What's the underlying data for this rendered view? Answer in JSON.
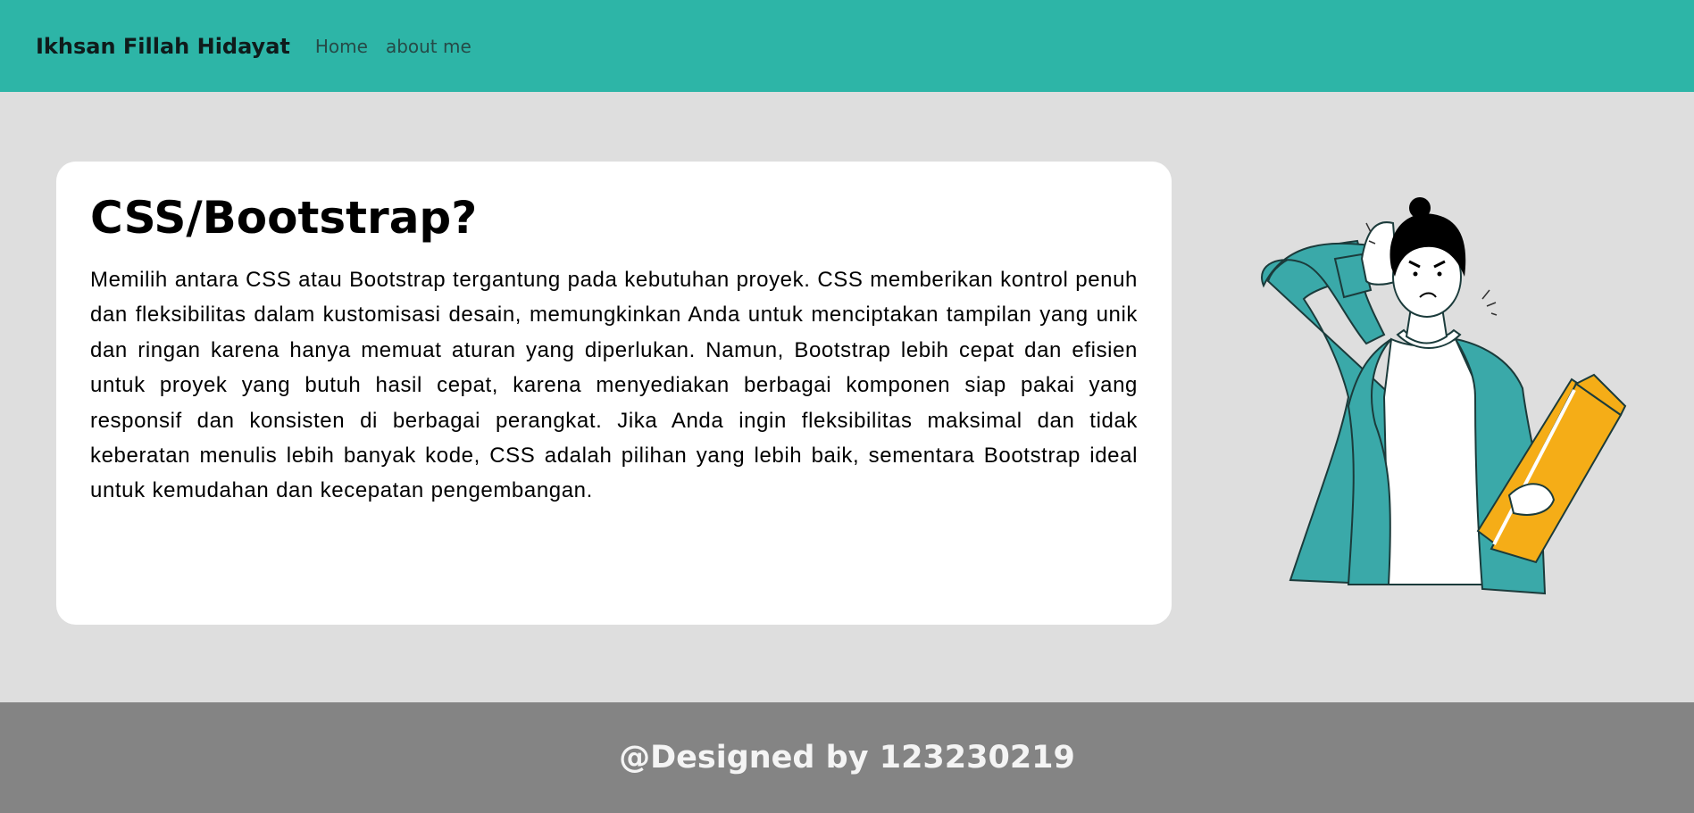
{
  "navbar": {
    "brand": "Ikhsan Fillah Hidayat",
    "links": [
      "Home",
      "about me"
    ],
    "background": "#2db5a7"
  },
  "card": {
    "title": "CSS/Bootstrap?",
    "body": "Memilih antara CSS atau Bootstrap tergantung pada kebutuhan proyek. CSS memberikan kontrol penuh dan fleksibilitas dalam kustomisasi desain, memungkinkan Anda untuk menciptakan tampilan yang unik dan ringan karena hanya memuat aturan yang diperlukan. Namun, Bootstrap lebih cepat dan efisien untuk proyek yang butuh hasil cepat, karena menyediakan berbagai komponen siap pakai yang responsif dan konsisten di berbagai perangkat. Jika Anda ingin fleksibilitas maksimal dan tidak keberatan menulis lebih banyak kode, CSS adalah pilihan yang lebih baik, sementara Bootstrap ideal untuk kemudahan dan kecepatan pengembangan."
  },
  "illustration": {
    "icon": "confused-person-illustration",
    "colors": {
      "jacket": "#3aa9a9",
      "folder": "#f5ad17",
      "hair": "#000000"
    }
  },
  "footer": {
    "text": "@Designed by 123230219",
    "background": "#848484"
  }
}
